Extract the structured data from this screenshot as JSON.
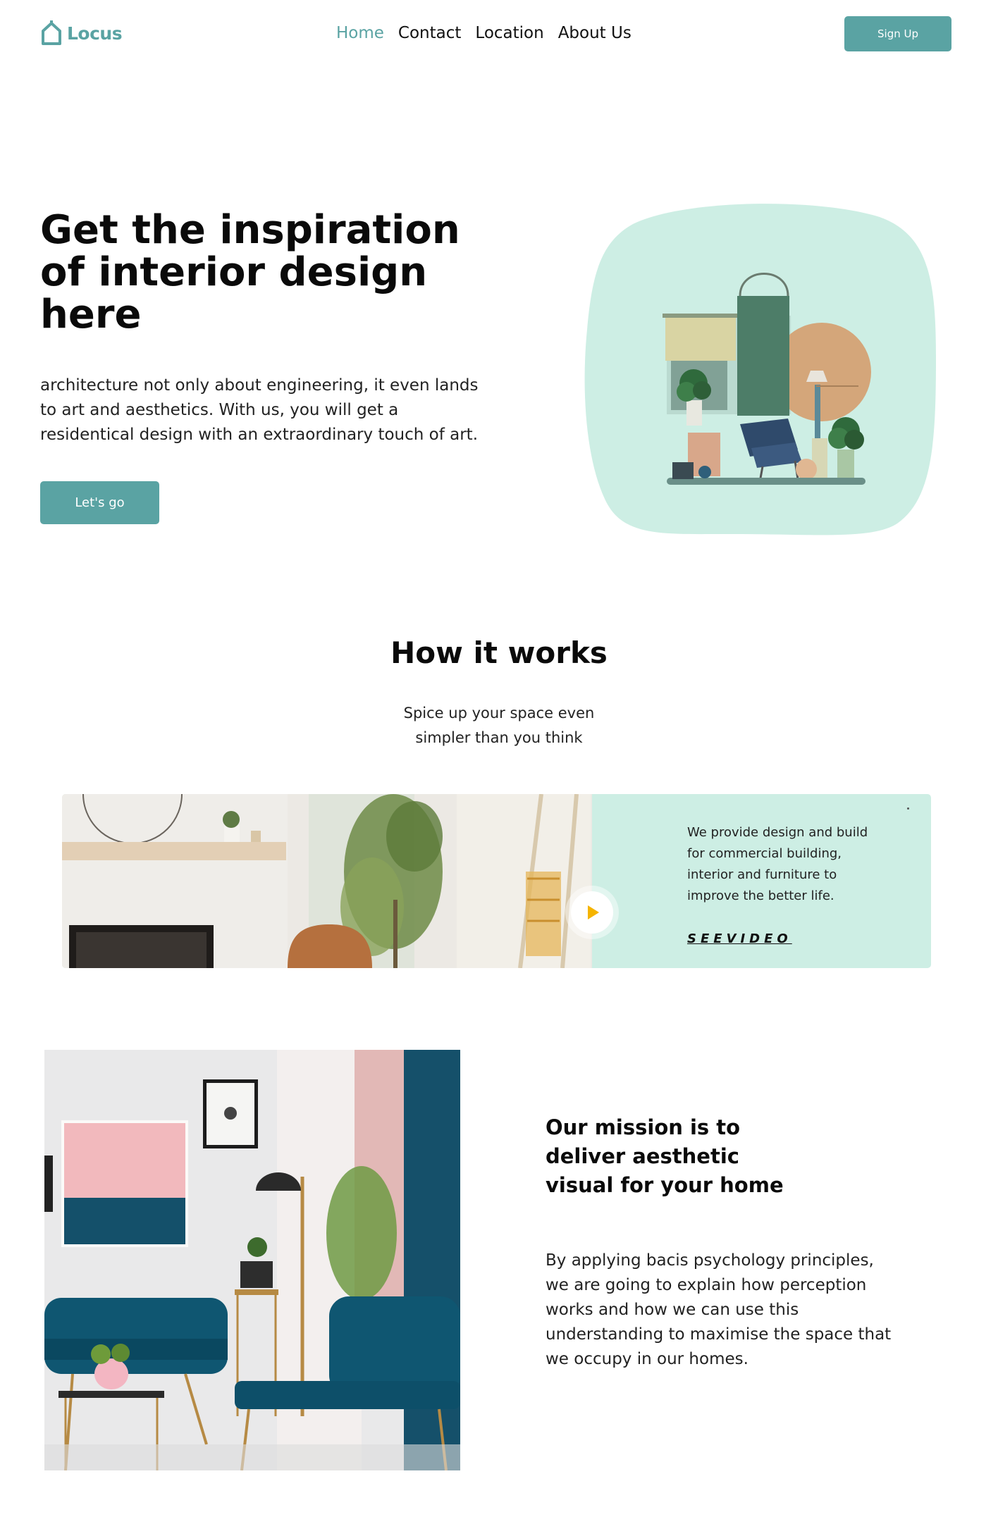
{
  "colors": {
    "accent": "#5aa3a3",
    "mint": "#cdeee4",
    "text": "#111111"
  },
  "nav": {
    "logo_text": "Locus",
    "logo_icon": "house-icon",
    "links": [
      {
        "label": "Home",
        "active": true
      },
      {
        "label": "Contact",
        "active": false
      },
      {
        "label": "Location",
        "active": false
      },
      {
        "label": "About Us",
        "active": false
      }
    ],
    "signup_label": "Sign Up"
  },
  "hero": {
    "title": "Get the inspiration of interior design here",
    "text": "architecture not only about engineering, it even lands to art and aesthetics. With us, you will get a residentical design with an extraordinary touch of art.",
    "cta_label": "Let's go"
  },
  "how": {
    "title": "How it works",
    "subtitle": "Spice up your space even simpler than you think",
    "card_text": "We provide design and build for commercial building, interior and furniture to improve the better life.",
    "see_video_label": "SEEVIDEO",
    "play_icon": "play-icon"
  },
  "mission": {
    "title": "Our mission is to deliver aesthetic visual for your home",
    "text": "By applying bacis psychology principles, we are going to explain how perception works and how we can use this understanding to maximise the space that we occupy in our homes."
  }
}
